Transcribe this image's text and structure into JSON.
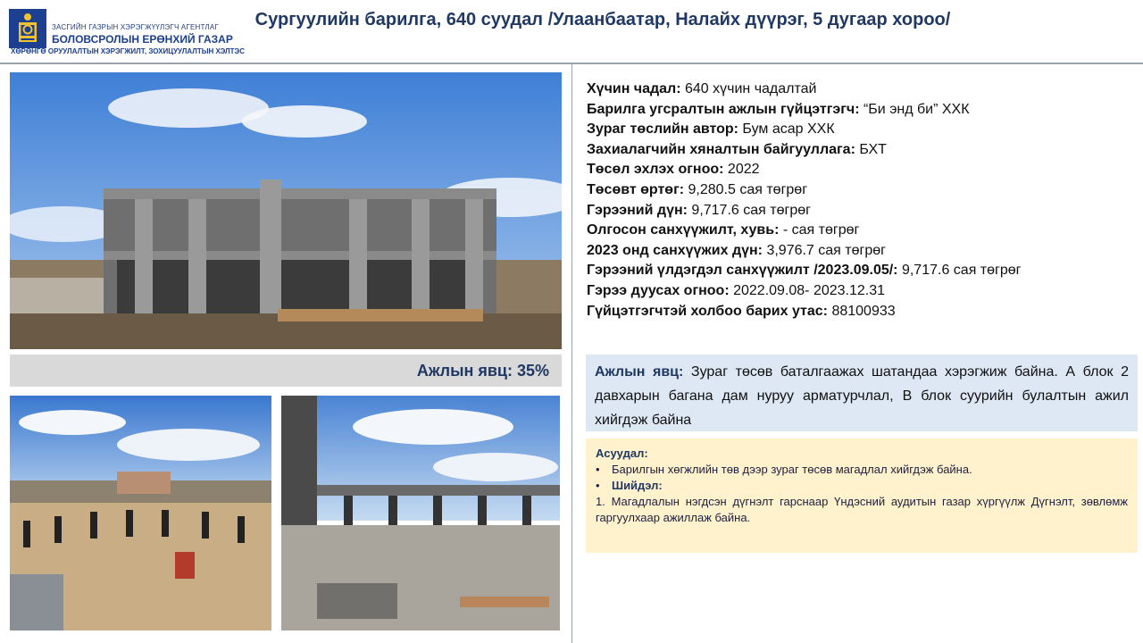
{
  "header": {
    "logo": {
      "agency": "ЗАСГИЙН ГАЗРЫН ХЭРЭГЖҮҮЛЭГЧ АГЕНТЛАГ",
      "name": "БОЛОВСРОЛЫН ЕРӨНХИЙ ГАЗАР",
      "slogan": "ХӨРӨНГӨ ОРУУЛАЛТЫН ХЭРЭГЖИЛТ, ЗОХИЦУУЛАЛТЫН ХЭЛТЭС"
    },
    "title": "Сургуулийн барилга, 640 суудал /Улаанбаатар, Налайх дүүрэг, 5 дугаар хороо/"
  },
  "progress": {
    "label": "Ажлын явц:",
    "value": "35%",
    "fraction": 0.35
  },
  "info": [
    {
      "label": "Хүчин чадал:",
      "value": " 640 хүчин чадалтай"
    },
    {
      "label": "Барилга угсралтын ажлын гүйцэтгэгч:",
      "value": " “Би энд би” ХХК"
    },
    {
      "label": "Зураг төслийн автор:",
      "value": " Бум асар ХХК"
    },
    {
      "label": "Захиалагчийн хяналтын байгууллага:",
      "value": " БХТ"
    },
    {
      "label": "Төсөл эхлэх огноо:",
      "value": " 2022"
    },
    {
      "label": "Төсөвт өртөг:",
      "value": "  9,280.5 сая төгрөг"
    },
    {
      "label": "Гэрээний дүн:",
      "value": " 9,717.6 сая төгрөг"
    },
    {
      "label": "Олгосон санхүүжилт, хувь:",
      "value": " - сая төгрөг"
    },
    {
      "label": "2023 онд санхүүжих дүн:",
      "value": " 3,976.7 сая төгрөг"
    },
    {
      "label": "Гэрээний үлдэгдэл санхүүжилт /2023.09.05/:",
      "value": " 9,717.6 сая төгрөг"
    },
    {
      "label": "Гэрээ дуусах огноо:",
      "value": " 2022.09.08- 2023.12.31"
    },
    {
      "label": "Гүйцэтгэгчтэй холбоо барих утас:",
      "value": " 88100933"
    }
  ],
  "status": {
    "label": "Ажлын явц:",
    "text": "  Зураг төсөв баталгаажах шатандаа хэрэгжиж байна. А блок 2 давхарын багана дам нуруу арматурчлал, В блок суурийн булалтын ажил хийгдэж байна"
  },
  "issues": {
    "problem_label": "Асуудал:",
    "problem_bullet": "•",
    "problem_text": "Барилгын хөгжлийн  төв дээр зураг төсөв магадлал хийгдэж  байна.",
    "solution_bullet": "•",
    "solution_label": "Шийдэл:",
    "solution_text": "1. Магадлалын нэгдсэн дүгнэлт гарснаар Үндэсний аудитын газар хүргүүлж Дүгнэлт, зөвлөмж гаргуулхаар ажиллаж байна."
  },
  "colors": {
    "title": "#1f3864",
    "status_bg": "#dde8f4",
    "issue_bg": "#fff2cc",
    "progress_bg": "#d9d9d9",
    "logo": "#1c3f8f"
  }
}
